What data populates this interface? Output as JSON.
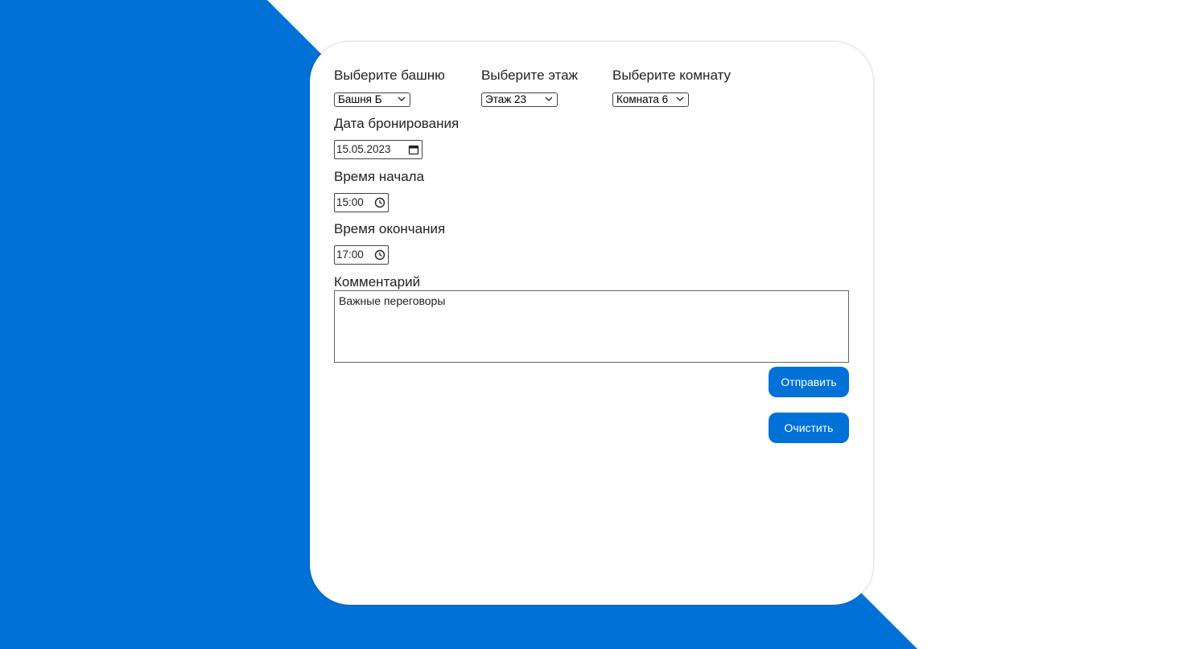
{
  "colors": {
    "accent": "#0072d7",
    "background": "#ffffff"
  },
  "form": {
    "tower": {
      "label": "Выберите башню",
      "value": "Башня Б"
    },
    "floor": {
      "label": "Выберите этаж",
      "value": "Этаж 23"
    },
    "room": {
      "label": "Выберите комнату",
      "value": "Комната 6"
    },
    "date": {
      "label": "Дата бронирования",
      "value": "15.05.2023",
      "icon": "calendar-icon"
    },
    "start_time": {
      "label": "Время начала",
      "value": "15:00",
      "icon": "clock-icon"
    },
    "end_time": {
      "label": "Время окончания",
      "value": "17:00",
      "icon": "clock-icon"
    },
    "comment": {
      "label": "Комментарий",
      "value": "Важные переговоры"
    },
    "submit_label": "Отправить",
    "clear_label": "Очистить"
  }
}
